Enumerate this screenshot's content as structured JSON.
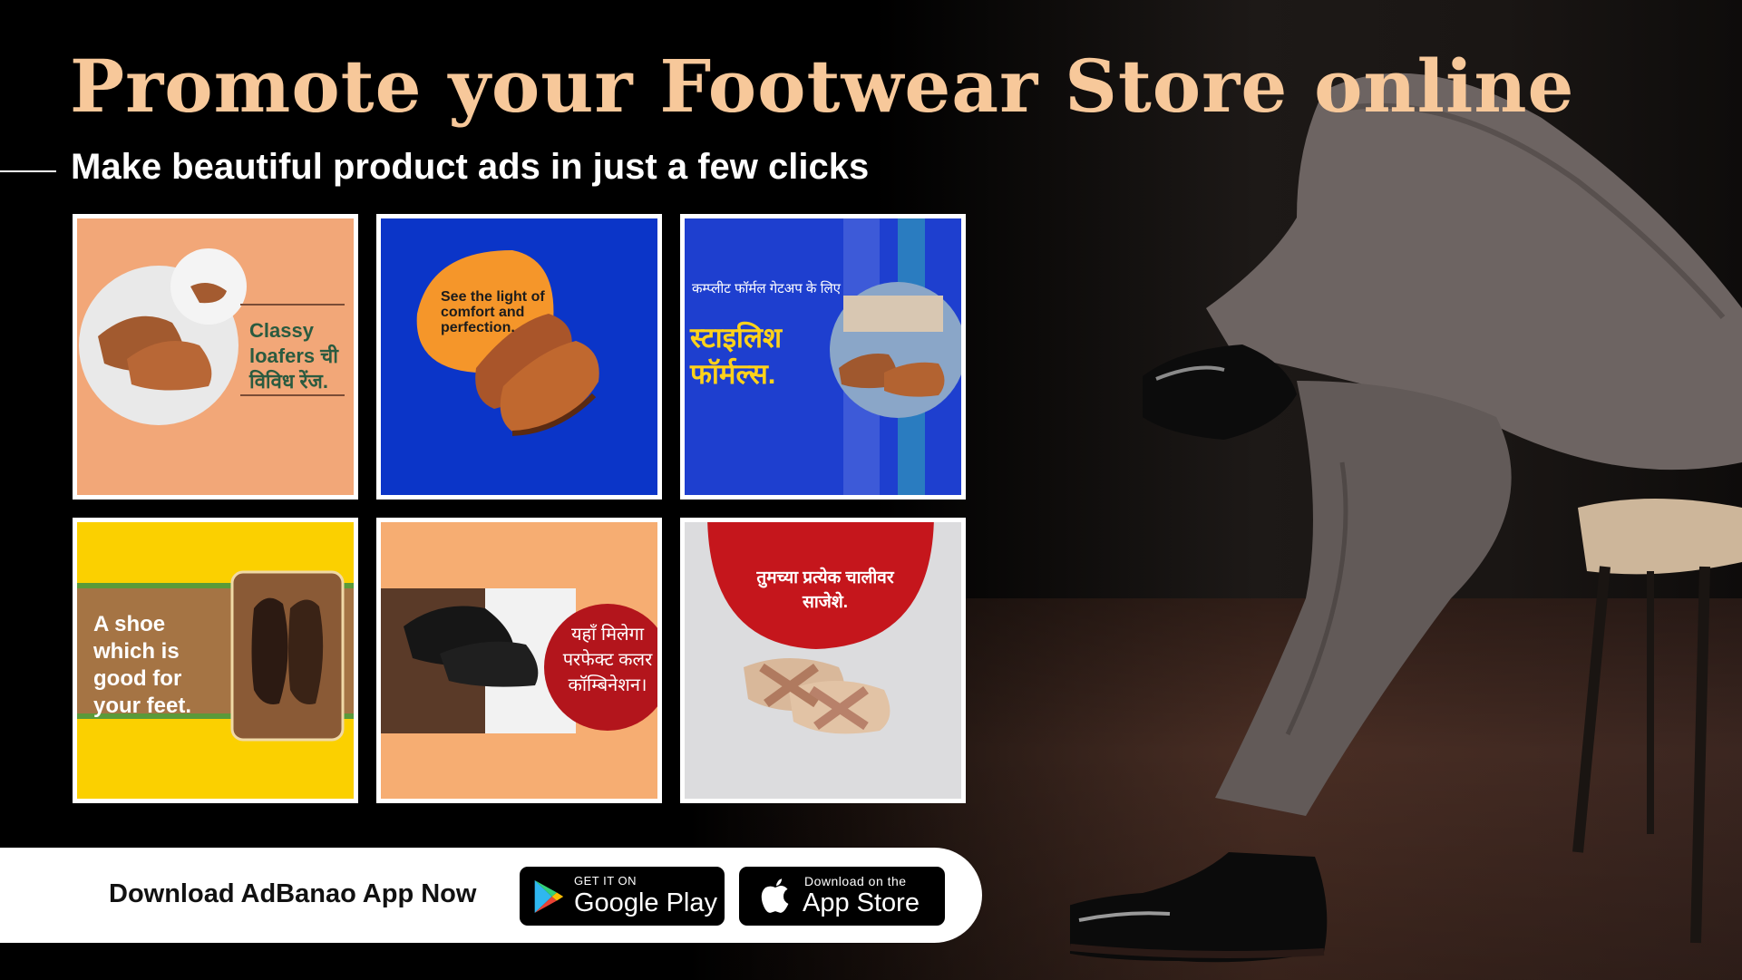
{
  "headline": "Promote your Footwear Store online",
  "subheadline": "Make beautiful product ads in just a few clicks",
  "cards": [
    {
      "text": "Classy loafers ची विविध रेंज."
    },
    {
      "text": "See the light of comfort and perfection."
    },
    {
      "text_small": "कम्प्लीट फॉर्मल गेटअप के लिए",
      "text_big": "स्टाइलिश फॉर्मल्स."
    },
    {
      "text": "A shoe which is good for your feet."
    },
    {
      "text": "यहाँ मिलेगा परफेक्ट कलर कॉम्बिनेशन।"
    },
    {
      "text": "तुमच्या प्रत्येक चालीवर साजेशे."
    }
  ],
  "download": {
    "label": "Download AdBanao App Now",
    "google_play": {
      "small": "GET IT ON",
      "big": "Google Play"
    },
    "app_store": {
      "small": "Download on the",
      "big": "App Store"
    }
  },
  "colors": {
    "headline": "#f7c89a",
    "subheadline": "#ffffff",
    "background": "#000000",
    "download_bar": "#ffffff"
  },
  "icons": [
    "google-play-icon",
    "apple-icon"
  ]
}
